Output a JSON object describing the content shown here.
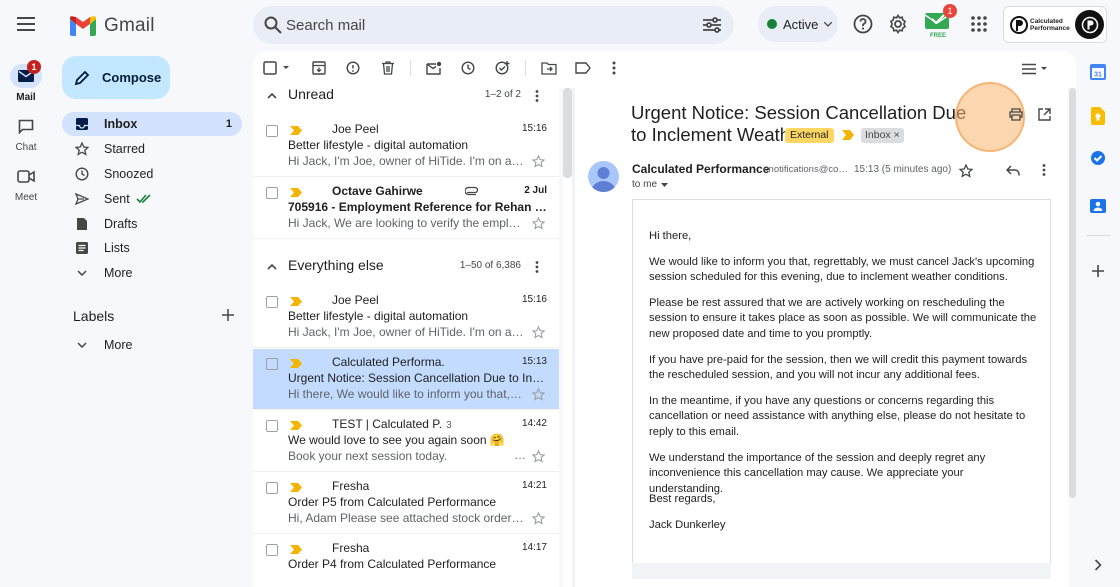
{
  "app": {
    "name": "Gmail"
  },
  "search": {
    "placeholder": "Search mail"
  },
  "status": {
    "label": "Active"
  },
  "free": {
    "label": "FREE",
    "badge": "1"
  },
  "account": {
    "name_line1": "Calculated",
    "name_line2": "Performance"
  },
  "rail": {
    "mail": {
      "label": "Mail",
      "badge": "1"
    },
    "chat": {
      "label": "Chat"
    },
    "meet": {
      "label": "Meet"
    }
  },
  "compose": {
    "label": "Compose"
  },
  "nav": {
    "items": [
      {
        "label": "Inbox",
        "count": "1"
      },
      {
        "label": "Starred"
      },
      {
        "label": "Snoozed"
      },
      {
        "label": "Sent"
      },
      {
        "label": "Drafts"
      },
      {
        "label": "Lists"
      },
      {
        "label": "More"
      }
    ]
  },
  "labels": {
    "title": "Labels",
    "more": "More"
  },
  "sections": [
    {
      "title": "Unread",
      "count": "1–2 of 2"
    },
    {
      "title": "Everything else",
      "count": "1–50 of 6,386"
    }
  ],
  "emails": [
    {
      "sender": "Joe Peel",
      "time": "15:16",
      "subject": "Better lifestyle - digital automation",
      "snippet": "Hi Jack, I'm Joe, owner of HiTide. I'm on a mission…"
    },
    {
      "sender": "Octave Gahirwe",
      "time": "2 Jul",
      "subject": "705916 - Employment Reference for Rehan …",
      "snippet": "Hi Jack, We are looking to verify the employment…"
    },
    {
      "sender": "Joe Peel",
      "time": "15:16",
      "subject": "Better lifestyle - digital automation",
      "snippet": "Hi Jack, I'm Joe, owner of HiTide. I'm on a mission…"
    },
    {
      "sender": "Calculated Performa.",
      "time": "15:13",
      "subject": "Urgent Notice: Session Cancellation Due to In…",
      "snippet": "Hi there, We would like to inform you that, regretta…"
    },
    {
      "sender": "TEST | Calculated P.",
      "count": "3",
      "time": "14:42",
      "subject": "We would love to see you again soon 🤗",
      "snippet": "Book your next session today.",
      "snippet_trail": "…"
    },
    {
      "sender": "Fresha",
      "time": "14:21",
      "subject": "Order P5 from Calculated Performance",
      "snippet": "Hi, Adam Please see attached stock order P5. …"
    },
    {
      "sender": "Fresha",
      "time": "14:17",
      "subject": "Order P4 from Calculated Performance",
      "snippet": ""
    }
  ],
  "reading": {
    "title": "Urgent Notice: Session Cancellation Due to Inclement Weather",
    "tag_external": "External",
    "tag_inbox": "Inbox",
    "from_name": "Calculated Performance",
    "from_email": "<notifications@co…",
    "sent_time": "15:13 (5 minutes ago)",
    "to": "to me",
    "body": [
      "Hi there,",
      "We would like to inform you that, regrettably, we must cancel Jack's upcoming session scheduled for this evening, due to inclement weather conditions.",
      "Please be rest assured that we are actively working on rescheduling the session to ensure it takes place as soon as possible. We will communicate the new proposed date and time to you promptly.",
      "If you have pre-paid for the session, then we will credit this payment towards the rescheduled session, and you will not incur any additional fees.",
      "In the meantime, if you have any questions or concerns regarding this cancellation or need assistance with anything else, please do not hesitate to reply to this email.",
      "We understand the importance of the session and deeply regret any inconvenience this cancellation may cause. We appreciate your understanding.",
      "Best regards,",
      "Jack Dunkerley"
    ]
  },
  "colors": {
    "accent": "#0b57d0",
    "compose_bg": "#c2e7ff",
    "selected_row": "#c2dbff",
    "external_tag": "#fdd663",
    "active": "#188038"
  }
}
